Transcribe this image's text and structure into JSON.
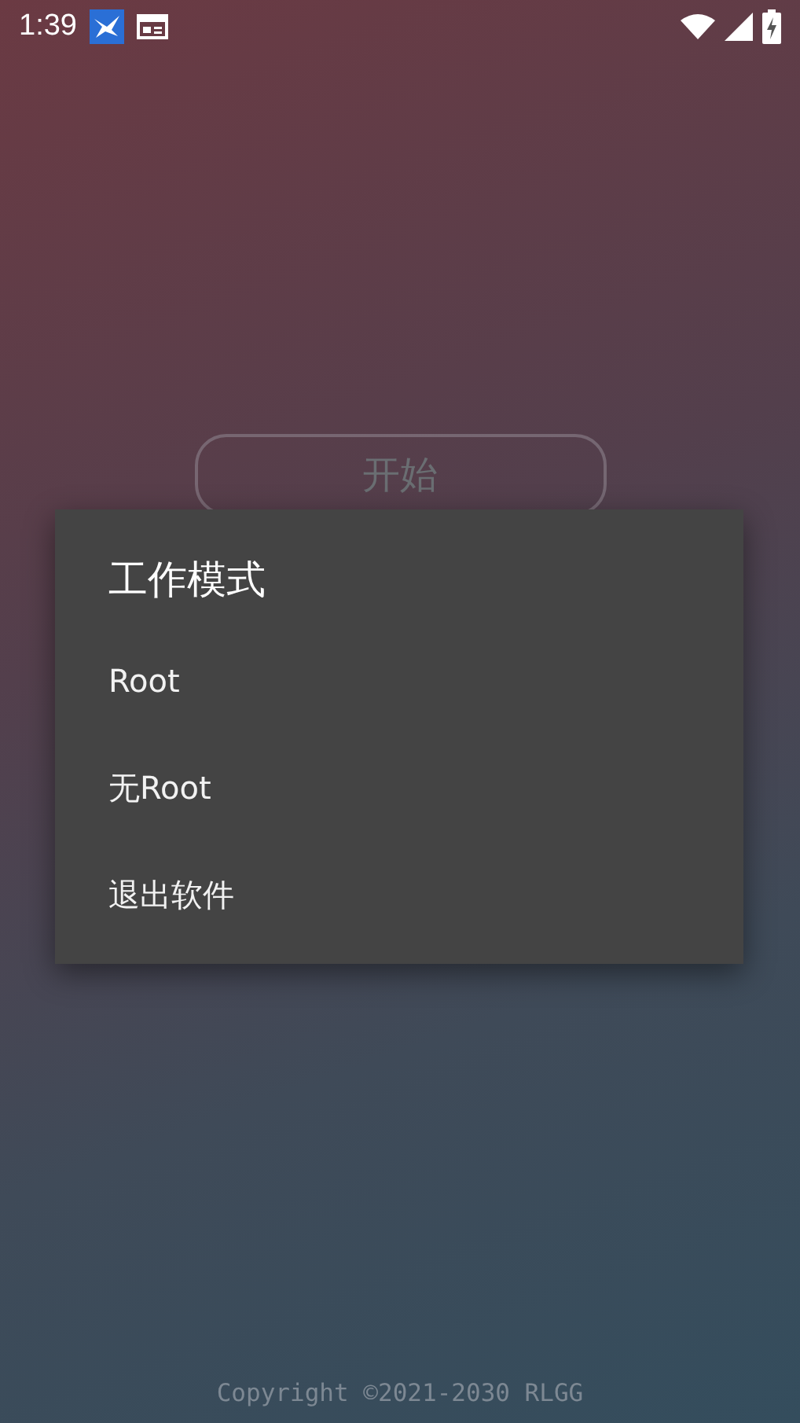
{
  "status_bar": {
    "time": "1:39"
  },
  "start_button": {
    "label": "开始"
  },
  "dialog": {
    "title": "工作模式",
    "items": [
      {
        "label": "Root"
      },
      {
        "label": "无Root"
      },
      {
        "label": "退出软件"
      }
    ]
  },
  "footer": {
    "copyright": "Copyright ©2021-2030 RLGG"
  }
}
